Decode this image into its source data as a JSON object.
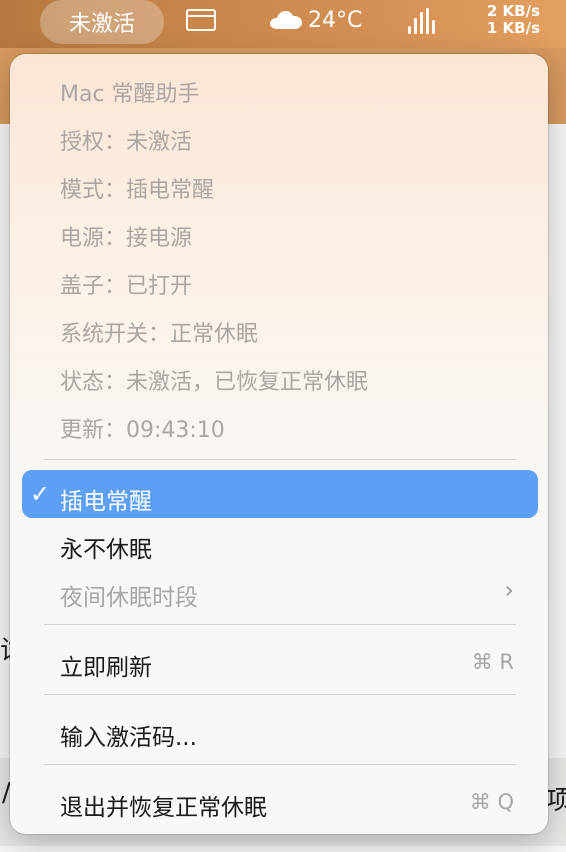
{
  "menubar": {
    "app_status": "未激活",
    "temperature": "24°C",
    "net_up": "2 KB/s",
    "net_down": "1 KB/s"
  },
  "menu": {
    "info": [
      "Mac 常醒助手",
      "授权：未激活",
      "模式：插电常醒",
      "电源：接电源",
      "盖子：已打开",
      "系统开关：正常休眠",
      "状态：未激活，已恢复正常休眠",
      "更新：09:43:10"
    ],
    "modes": {
      "check": "✓",
      "plugged_awake": "插电常醒",
      "never_sleep": "永不休眠",
      "night_sleep": "夜间休眠时段"
    },
    "refresh": {
      "label": "立即刷新",
      "shortcut": "⌘ R"
    },
    "activate": {
      "label": "输入激活码..."
    },
    "quit": {
      "label": "退出并恢复正常休眠",
      "shortcut": "⌘ Q"
    }
  },
  "background": {
    "left_char_1": "试",
    "right_char": "项",
    "left_char_2": "/"
  }
}
